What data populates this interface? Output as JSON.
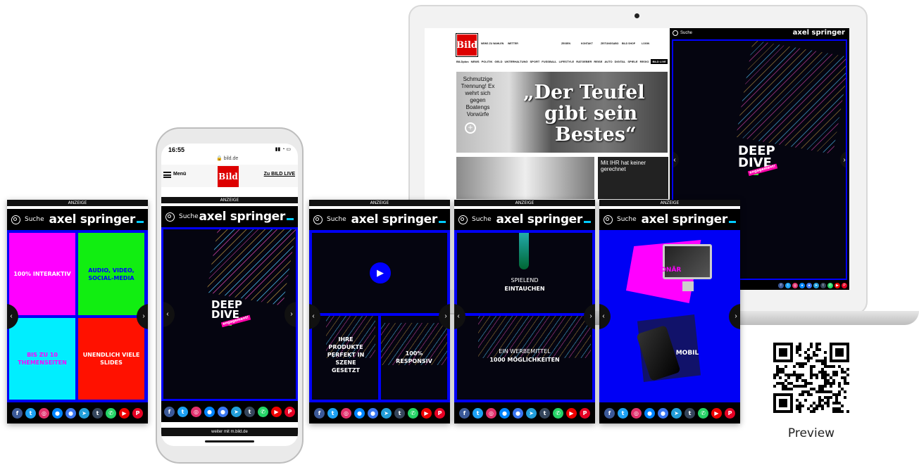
{
  "ad_label": "ANZEIGE",
  "search_label": "Suche",
  "brand": "axel springer",
  "social_icons": [
    "facebook-icon",
    "twitter-icon",
    "instagram-icon",
    "messenger-icon",
    "signal-icon",
    "telegram-icon",
    "tumblr-icon",
    "whatsapp-icon",
    "youtube-icon",
    "pinterest-icon"
  ],
  "social_glyphs": [
    "f",
    "t",
    "◎",
    "●",
    "●",
    "➤",
    "t",
    "✆",
    "▶",
    "P"
  ],
  "social_colors": [
    "#3b5998",
    "#1da1f2",
    "#e1306c",
    "#0084ff",
    "#3a76f0",
    "#229ed9",
    "#35465c",
    "#25d366",
    "#e00",
    "#e60023"
  ],
  "panel1": {
    "tiles": [
      "100% INTERAKTIV",
      "AUDIO, VIDEO, SOCIAL-MEDIA",
      "BIS ZU 10 THEMENSEITEN",
      "UNENDLICH VIELE SLIDES"
    ]
  },
  "deep_dive": {
    "line1": "DEEP",
    "line2": "DIVE",
    "tag": "engagement!"
  },
  "panel3": {
    "left": "IHRE PRODUKTE PERFEKT IN SZENE GESETZT",
    "right": "100% RESPONSIV"
  },
  "panel4": {
    "top1": "SPIELEND",
    "top2": "EINTAUCHEN",
    "bottom1": "EIN WERBEMITTEL",
    "bottom2": "1000 MÖGLICHKEITEN"
  },
  "panel5": {
    "top": "STATIONÄR",
    "bottom": "MOBIL"
  },
  "phone": {
    "time": "16:55",
    "url": "bild.de",
    "menu": "Menü",
    "logo": "Bild",
    "cta": "Zu BILD LIVE",
    "footer": "weiter mit m.bild.de"
  },
  "laptop": {
    "logo": "Bild",
    "top_links": [
      "NEWS ZU WAHLEN",
      "WETTER",
      "ZEIGEN",
      "KONTAKT",
      "ZEITUNGSABO",
      "BILD SHOP",
      "LOGIN"
    ],
    "nav": [
      "BILDplus",
      "NEWS",
      "POLITIK",
      "GELD",
      "UNTERHALTUNG",
      "SPORT",
      "FUSSBALL",
      "LIFESTYLE",
      "RATGEBER",
      "REISE",
      "AUTO",
      "DIGITAL",
      "SPIELE",
      "REGIO",
      "BILD LIVE"
    ],
    "teaser_small": "Schmutzige Trennung! Ex wehrt sich gegen Boatengs Vorwürfe",
    "headline1": "„Der Teufel",
    "headline2": "gibt sein",
    "headline3": "Bestes“",
    "teaser2": "Mit IHR hat keiner gerechnet"
  },
  "qr": {
    "caption": "Preview"
  }
}
